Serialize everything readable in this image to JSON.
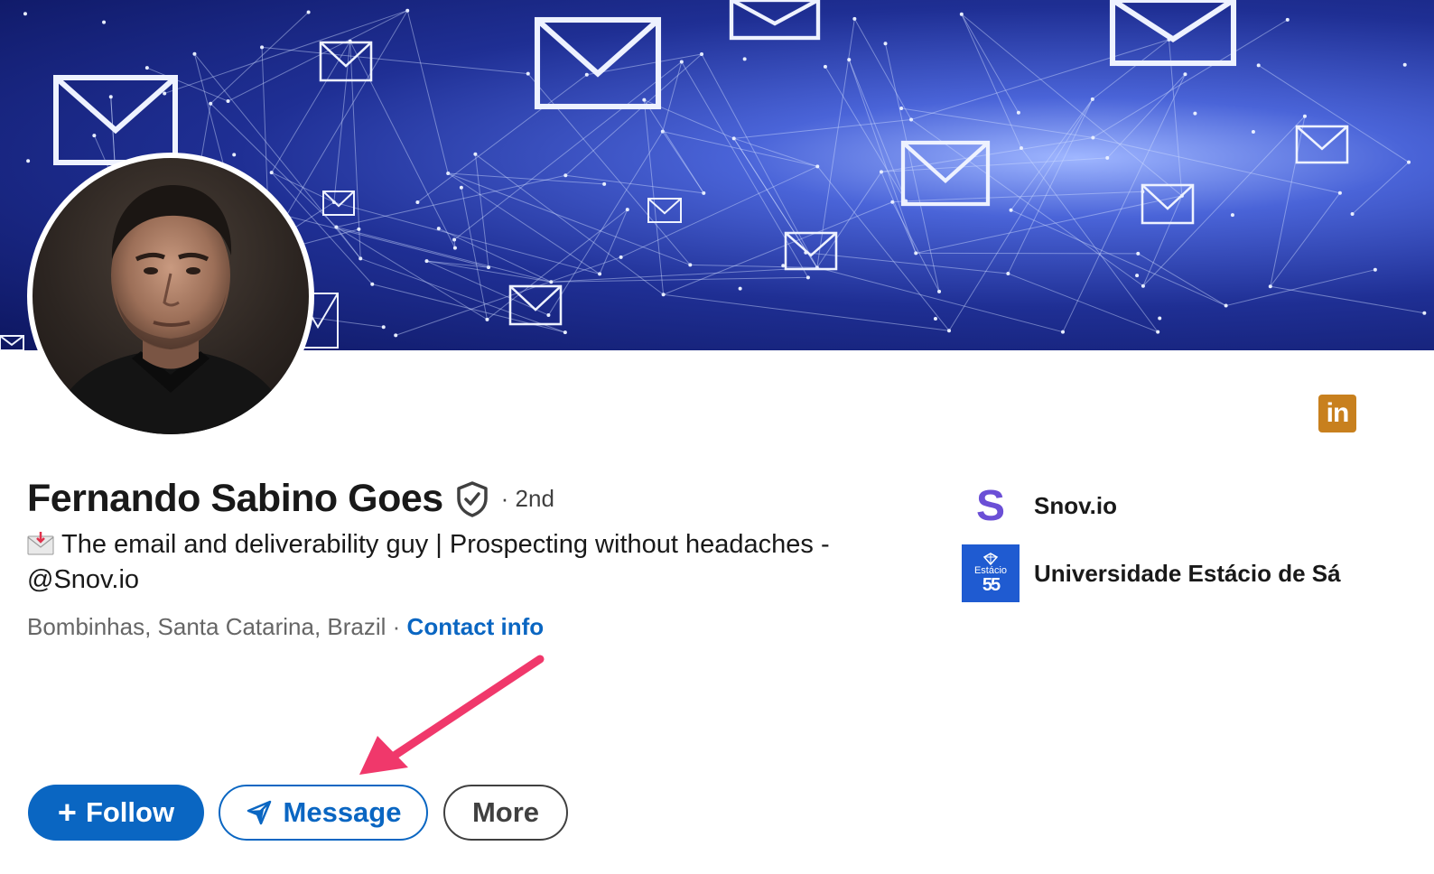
{
  "profile": {
    "name": "Fernando Sabino Goes",
    "degree": "· 2nd",
    "headline": "The email and deliverability guy | Prospecting without headaches - @Snov.io",
    "location": "Bombinhas, Santa Catarina, Brazil",
    "location_separator": " · ",
    "contact_label": "Contact info",
    "linkedin_badge": "in"
  },
  "organizations": [
    {
      "name": "Snov.io",
      "logo_letter": "S"
    },
    {
      "name": "Universidade Estácio de Sá",
      "logo_text": "Estácio",
      "logo_number": "55"
    }
  ],
  "actions": {
    "follow_icon": "+",
    "follow_label": "Follow",
    "message_label": "Message",
    "more_label": "More"
  },
  "colors": {
    "primary_blue": "#0a66c2",
    "annotation_arrow": "#f0386b",
    "linkedin_badge": "#c8801e"
  },
  "icons": [
    "verified-shield-icon",
    "envelope-emoji-icon",
    "paper-plane-icon",
    "plus-icon",
    "linkedin-icon",
    "annotation-arrow"
  ]
}
